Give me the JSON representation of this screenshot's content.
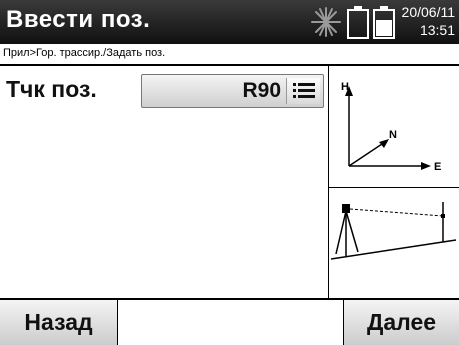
{
  "header": {
    "title": "Ввести поз.",
    "date": "20/06/11",
    "time": "13:51",
    "icons": [
      "sun-star-icon",
      "battery-icon",
      "battery-icon"
    ]
  },
  "breadcrumb": "Прил>Гор. трассир./Задать поз.",
  "form": {
    "point_label": "Тчк поз.",
    "point_value": "R90",
    "list_icon": "list-icon"
  },
  "diagram": {
    "axis_h": "H",
    "axis_n": "N",
    "axis_e": "E"
  },
  "softkeys": {
    "back": "Назад",
    "next": "Далее"
  }
}
